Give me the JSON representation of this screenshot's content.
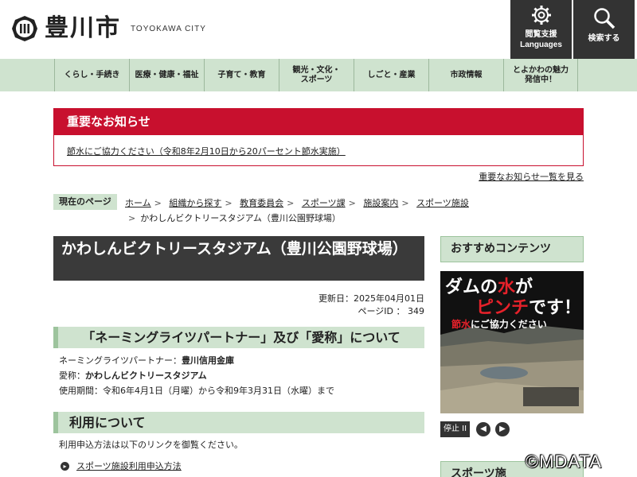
{
  "header": {
    "logo_text": "豊川市",
    "logo_en": "TOYOKAWA CITY",
    "access_label": "閲覧支援",
    "access_sub": "Languages",
    "search_label": "検索する"
  },
  "nav": {
    "items": [
      {
        "label": "くらし・手続き"
      },
      {
        "label": "医療・健康・福祉"
      },
      {
        "label": "子育て・教育"
      },
      {
        "label": "観光・文化・\nスポーツ"
      },
      {
        "label": "しごと・産業"
      },
      {
        "label": "市政情報"
      },
      {
        "label": "とよかわの魅力\n発信中！"
      }
    ]
  },
  "notice": {
    "title": "重要なお知らせ",
    "item": "節水にご協力ください（令和8年2月10日から20パーセント節水実施）",
    "all_link": "重要なお知らせ一覧を見る"
  },
  "breadcrumb": {
    "label": "現在のページ",
    "items": [
      "ホーム",
      "組織から探す",
      "教育委員会",
      "スポーツ課",
      "施設案内",
      "スポーツ施設"
    ],
    "current": "かわしんビクトリースタジアム（豊川公園野球場）"
  },
  "main": {
    "title": "かわしんビクトリースタジアム（豊川公園野球場）",
    "updated": "更新日：2025年04月01日",
    "page_id": "ページID ： 349",
    "section1_heading": "「ネーミングライツパートナー」及び「愛称」について",
    "partner_label": "ネーミングライツパートナー：",
    "partner_value": "豊川信用金庫",
    "nickname_label": "愛称：",
    "nickname_value": "かわしんビクトリースタジアム",
    "period": "使用期間：令和6年4月1日（月曜）から令和9年3月31日（水曜）まで",
    "section2_heading": "利用について",
    "usage_text": "利用申込方法は以下のリンクを御覧ください。",
    "usage_link": "スポーツ施設利用申込方法"
  },
  "side": {
    "recommend_heading": "おすすめコンテンツ",
    "banner_line1_a": "ダムの",
    "banner_line1_b": "水",
    "banner_line1_c": "が",
    "banner_line2_a": "ピンチ",
    "banner_line2_b": "です！",
    "banner_line3_a": "節水",
    "banner_line3_b": "にご協力ください",
    "stop_label": "停止 II",
    "sports_heading": "スポーツ施"
  },
  "watermark": "©MDATA",
  "colors": {
    "accent_red": "#c8102e",
    "nav_green": "#cfe3cf",
    "header_dark": "#333333"
  }
}
